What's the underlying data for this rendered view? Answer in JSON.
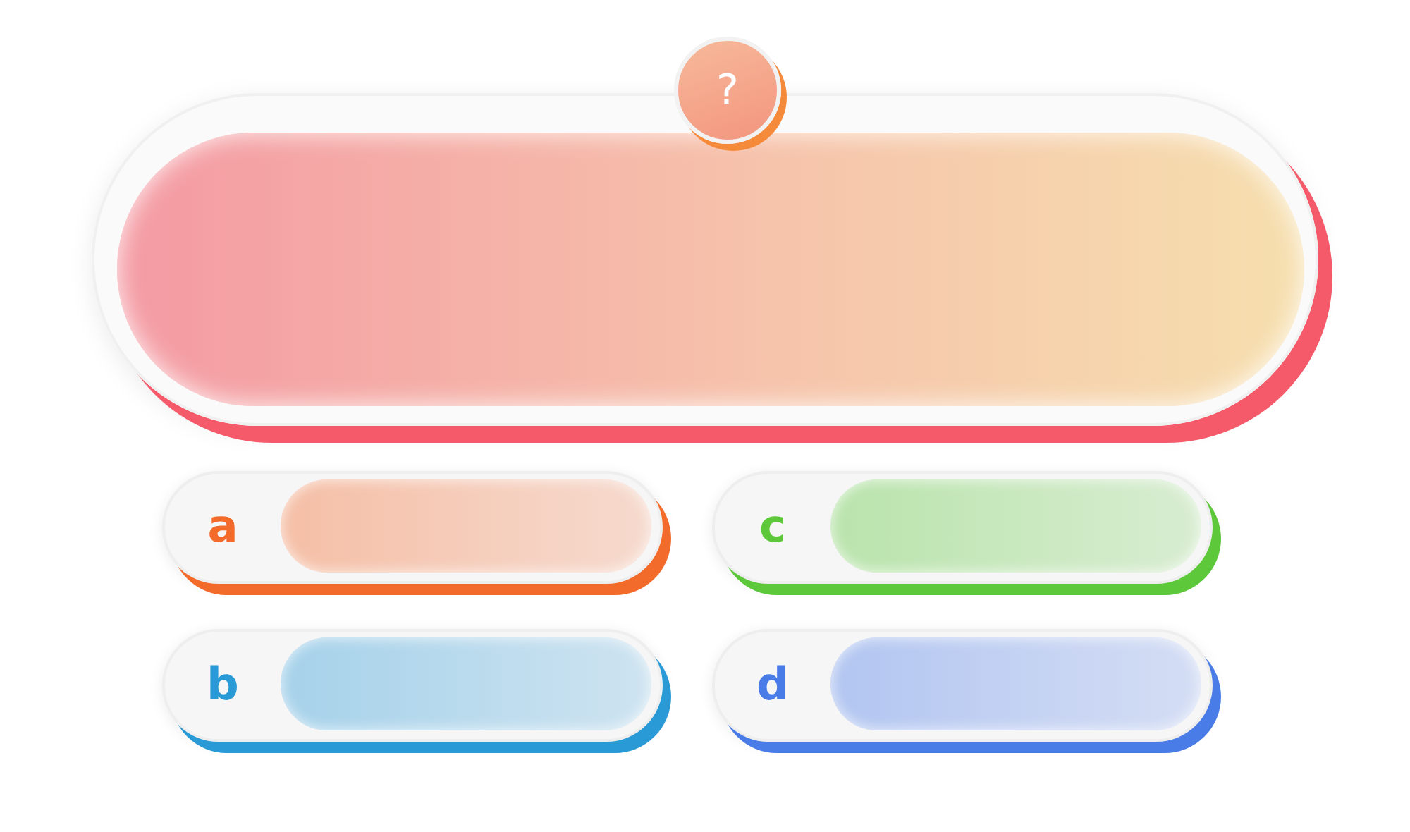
{
  "question": {
    "badge": "?"
  },
  "answers": [
    {
      "letter": "a",
      "color": "#f26b2b"
    },
    {
      "letter": "b",
      "color": "#2a9ad6"
    },
    {
      "letter": "c",
      "color": "#5cc83a"
    },
    {
      "letter": "d",
      "color": "#4a7ce8"
    }
  ]
}
